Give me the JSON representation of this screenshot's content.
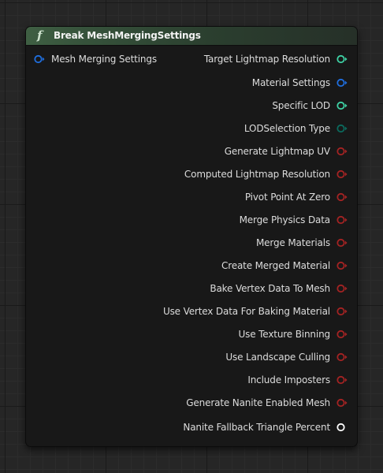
{
  "node": {
    "title": "Break MeshMergingSettings",
    "function_icon": "f",
    "input_pin": {
      "label": "Mesh Merging Settings",
      "color": "#1f6fe0",
      "icon": "struct-pin-icon"
    },
    "output_pins": [
      {
        "label": "Target Lightmap Resolution",
        "color": "#3fd3a6",
        "icon": "int-pin-icon"
      },
      {
        "label": "Material Settings",
        "color": "#1f6fe0",
        "icon": "struct-pin-icon"
      },
      {
        "label": "Specific LOD",
        "color": "#3fd3a6",
        "icon": "int-pin-icon"
      },
      {
        "label": "LODSelection Type",
        "color": "#0b6b5e",
        "icon": "byte-pin-icon"
      },
      {
        "label": "Generate Lightmap UV",
        "color": "#a52323",
        "icon": "bool-pin-icon"
      },
      {
        "label": "Computed Lightmap Resolution",
        "color": "#a52323",
        "icon": "bool-pin-icon"
      },
      {
        "label": "Pivot Point At Zero",
        "color": "#a52323",
        "icon": "bool-pin-icon"
      },
      {
        "label": "Merge Physics Data",
        "color": "#a52323",
        "icon": "bool-pin-icon"
      },
      {
        "label": "Merge Materials",
        "color": "#a52323",
        "icon": "bool-pin-icon"
      },
      {
        "label": "Create Merged Material",
        "color": "#a52323",
        "icon": "bool-pin-icon"
      },
      {
        "label": "Bake Vertex Data To Mesh",
        "color": "#a52323",
        "icon": "bool-pin-icon"
      },
      {
        "label": "Use Vertex Data For Baking Material",
        "color": "#a52323",
        "icon": "bool-pin-icon"
      },
      {
        "label": "Use Texture Binning",
        "color": "#a52323",
        "icon": "bool-pin-icon"
      },
      {
        "label": "Use Landscape Culling",
        "color": "#a52323",
        "icon": "bool-pin-icon"
      },
      {
        "label": "Include Imposters",
        "color": "#a52323",
        "icon": "bool-pin-icon"
      },
      {
        "label": "Generate Nanite Enabled Mesh",
        "color": "#a52323",
        "icon": "bool-pin-icon"
      },
      {
        "label": "Nanite Fallback Triangle Percent",
        "color": "#ffffff",
        "icon": "float-pin-icon"
      }
    ]
  }
}
